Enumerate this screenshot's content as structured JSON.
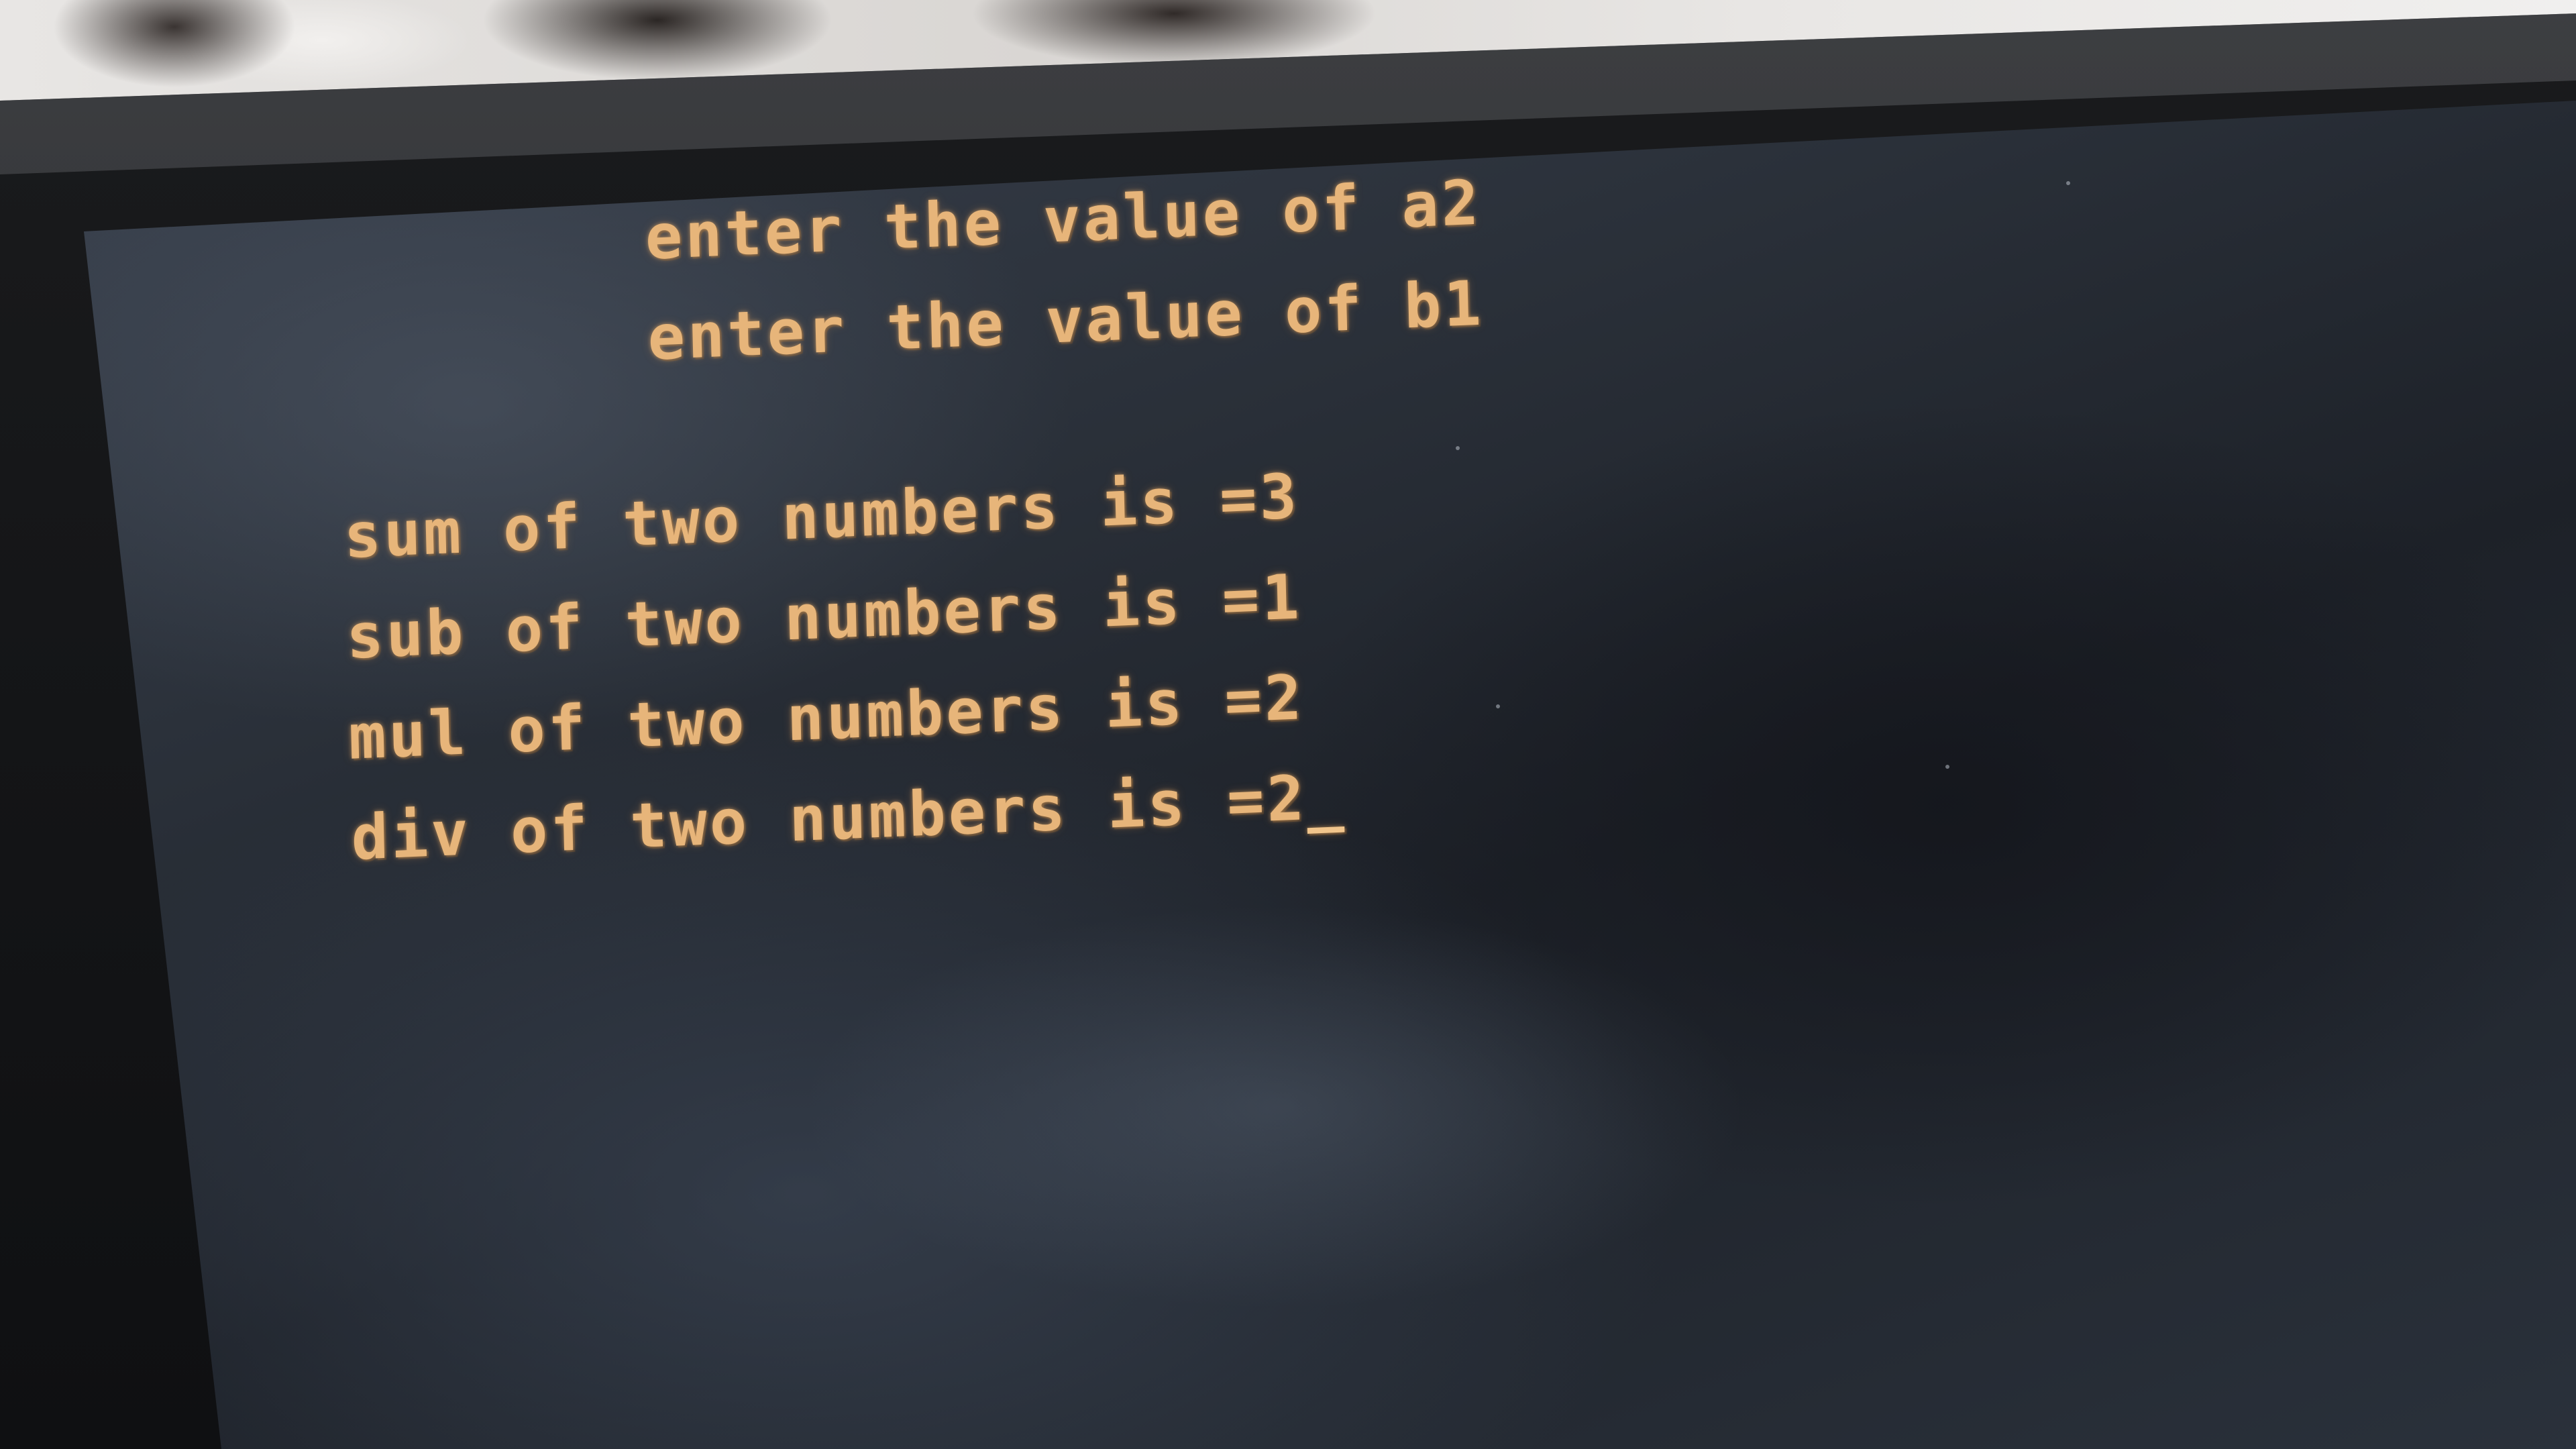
{
  "terminal": {
    "prompt_lines": [
      "enter the value of a2",
      "enter the value of b1"
    ],
    "result_lines": [
      "sum of two numbers is =3",
      "sub of two numbers is =1",
      "mul of two numbers is =2",
      "div of two numbers is =2"
    ],
    "cursor": "_",
    "text_color": "#e7b57a",
    "background_color": "#2a3039"
  }
}
